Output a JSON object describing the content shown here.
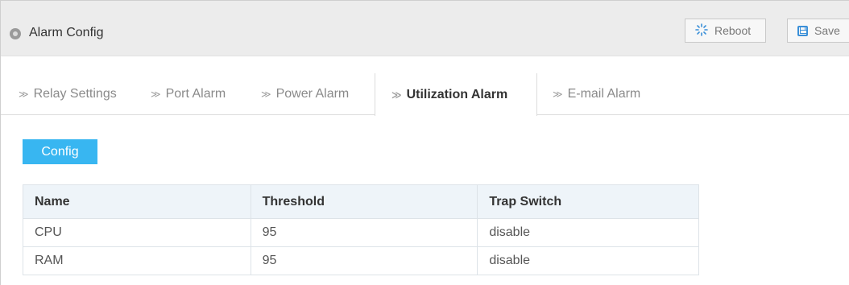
{
  "header": {
    "title": "Alarm Config",
    "reboot_label": "Reboot",
    "save_label": "Save",
    "reboot_icon": "spinner-icon",
    "save_icon": "floppy-disk-icon"
  },
  "tabs": [
    {
      "label": "Relay Settings",
      "active": false
    },
    {
      "label": "Port Alarm",
      "active": false
    },
    {
      "label": "Power Alarm",
      "active": false
    },
    {
      "label": "Utilization Alarm",
      "active": true
    },
    {
      "label": "E-mail Alarm",
      "active": false
    }
  ],
  "config_button": {
    "label": "Config"
  },
  "table": {
    "columns": [
      "Name",
      "Threshold",
      "Trap Switch"
    ],
    "rows": [
      [
        "CPU",
        "95",
        "disable"
      ],
      [
        "RAM",
        "95",
        "disable"
      ]
    ]
  },
  "colors": {
    "accent": "#38b6f1",
    "header_bg": "#ececec",
    "table_header_bg": "#eef4f9"
  }
}
